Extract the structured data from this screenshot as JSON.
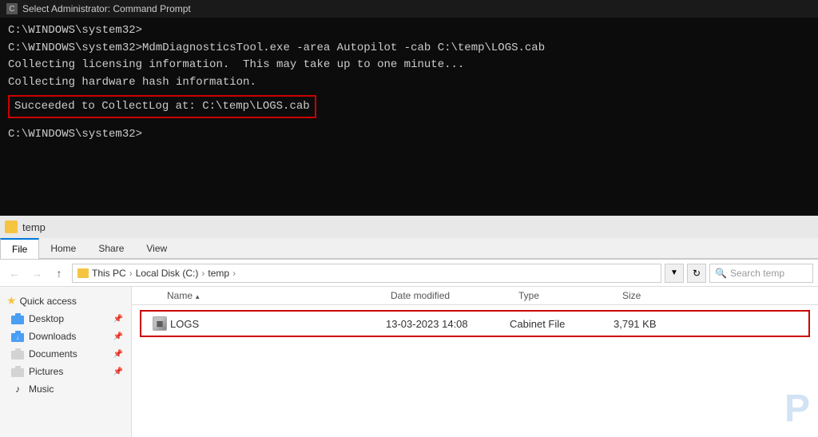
{
  "cmd": {
    "title": "Select Administrator: Command Prompt",
    "lines": [
      "C:\\WINDOWS\\system32>",
      "C:\\WINDOWS\\system32>MdmDiagnosticsTool.exe -area Autopilot -cab C:\\temp\\LOGS.cab",
      "Collecting licensing information.  This may take up to one minute...",
      "Collecting hardware hash information."
    ],
    "success_line": "Succeeded to CollectLog at: C:\\temp\\LOGS.cab",
    "prompt_line": "C:\\WINDOWS\\system32>"
  },
  "explorer": {
    "title": "temp",
    "ribbon_tabs": [
      "File",
      "Home",
      "Share",
      "View"
    ],
    "active_tab": "File",
    "breadcrumb": [
      "This PC",
      "Local Disk (C:)",
      "temp"
    ],
    "search_placeholder": "Search temp",
    "columns": [
      {
        "label": "Name",
        "key": "name"
      },
      {
        "label": "Date modified",
        "key": "date"
      },
      {
        "label": "Type",
        "key": "type"
      },
      {
        "label": "Size",
        "key": "size"
      }
    ],
    "files": [
      {
        "name": "LOGS",
        "date": "13-03-2023 14:08",
        "type": "Cabinet File",
        "size": "3,791 KB"
      }
    ],
    "sidebar": {
      "quick_access_label": "Quick access",
      "items": [
        {
          "label": "Desktop",
          "pinned": true,
          "icon": "folder-blue"
        },
        {
          "label": "Downloads",
          "pinned": true,
          "icon": "folder-blue-down"
        },
        {
          "label": "Documents",
          "pinned": true,
          "icon": "folder-docs"
        },
        {
          "label": "Pictures",
          "pinned": true,
          "icon": "folder-pics"
        },
        {
          "label": "Music",
          "pinned": false,
          "icon": "music"
        }
      ]
    }
  }
}
